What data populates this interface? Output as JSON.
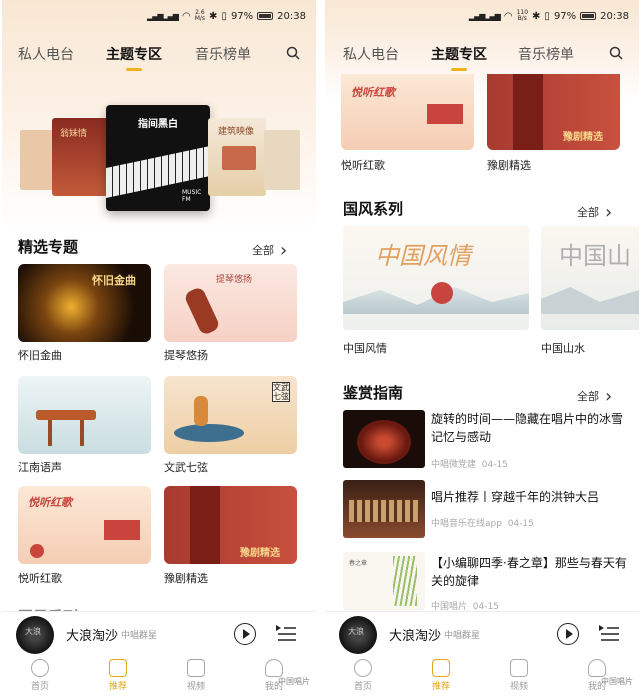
{
  "status": {
    "time": "20:38",
    "battery": "97%",
    "speed_left": [
      "2.6",
      "M/s"
    ],
    "speed_right": [
      "110",
      "B/s"
    ]
  },
  "nav": {
    "tabs": [
      "私人电台",
      "主题专区",
      "音乐榜单"
    ],
    "active": 1
  },
  "left": {
    "hero_cover_title": "指间黑白",
    "hero_cover_badge": [
      "MUSIC",
      "FM"
    ],
    "hero_side_left": "翁妹情",
    "hero_side_right": "建筑映像",
    "featured": {
      "title": "精选专题",
      "all": "全部"
    },
    "cards": [
      {
        "label": "怀旧金曲",
        "cover_text": "怀旧金曲"
      },
      {
        "label": "提琴悠扬",
        "cover_text": "提琴悠扬"
      },
      {
        "label": "江南语声",
        "cover_text": ""
      },
      {
        "label": "文武七弦",
        "cover_text": "文武七弦"
      },
      {
        "label": "悦听红歌",
        "cover_text": "悦听红歌"
      },
      {
        "label": "豫剧精选",
        "cover_text": "豫剧精选"
      }
    ],
    "next_section_partial": "国风系列"
  },
  "right": {
    "top_cards": [
      {
        "label": "悦听红歌",
        "cover_text": "悦听红歌"
      },
      {
        "label": "豫剧精选",
        "cover_text": "豫剧精选"
      }
    ],
    "guofeng": {
      "title": "国风系列",
      "all": "全部",
      "items": [
        {
          "label": "中国风情",
          "cover_text": "中国风情"
        },
        {
          "label": "中国山水",
          "cover_text": "中国山"
        }
      ]
    },
    "guide": {
      "title": "鉴赏指南",
      "all": "全部",
      "items": [
        {
          "title": "旋转的时间——隐藏在唱片中的冰雪记忆与感动",
          "source": "中唱微党建",
          "date": "04-15"
        },
        {
          "title": "唱片推荐丨穿越千年的洪钟大吕",
          "source": "中唱音乐在线app",
          "date": "04-15"
        },
        {
          "title": "【小编聊四季·春之章】那些与春天有关的旋律",
          "source": "中国唱片",
          "date": "04-15",
          "thumb_text": "春之章"
        }
      ]
    }
  },
  "player": {
    "title": "大浪淘沙",
    "artist": "中唱群星",
    "disc_text": "大浪"
  },
  "tabbar": {
    "items": [
      "首页",
      "推荐",
      "视频",
      "我的"
    ],
    "active": 1
  },
  "watermark": "中国唱片",
  "colors": {
    "accent": "#f2b21c",
    "red": "#c8443c",
    "gold": "#e3a51a"
  }
}
